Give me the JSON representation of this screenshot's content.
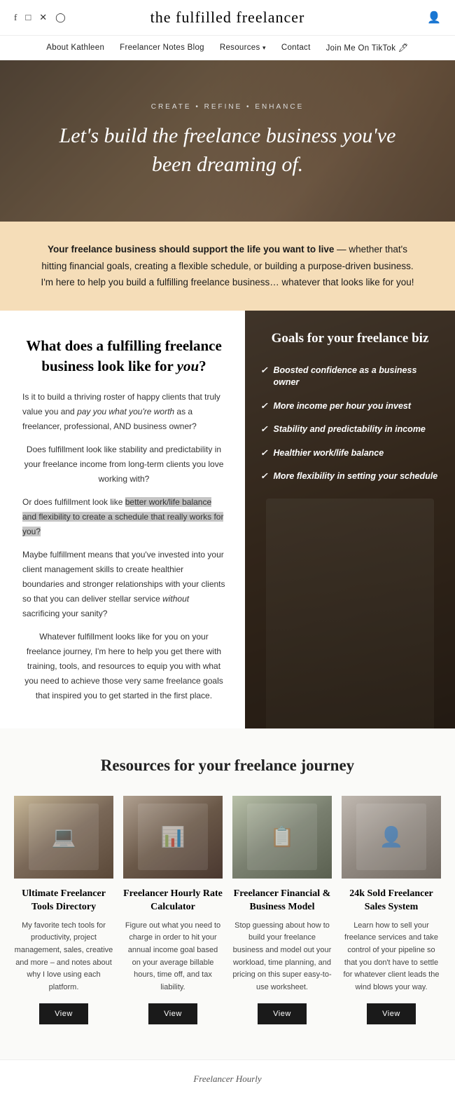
{
  "site": {
    "title": "the fulfilled freelancer",
    "tagline": "CREATE • REFINE • ENHANCE",
    "hero_headline": "Let's build the freelance business you've been dreaming of."
  },
  "social": {
    "icons": [
      "f",
      "i",
      "t",
      "p"
    ]
  },
  "nav": {
    "items": [
      {
        "label": "About Kathleen",
        "has_dropdown": false
      },
      {
        "label": "Freelancer Notes Blog",
        "has_dropdown": false
      },
      {
        "label": "Resources",
        "has_dropdown": true
      },
      {
        "label": "Contact",
        "has_dropdown": false
      },
      {
        "label": "Join Me On TikTok 🖊",
        "has_dropdown": false
      }
    ]
  },
  "intro": {
    "text_bold": "Your freelance business should support the life you want to live",
    "text_rest": " — whether that's hitting financial goals, creating a flexible schedule, or building a purpose-driven business. I'm here to help you build a fulfilling freelance business… whatever that looks like for you!"
  },
  "left_section": {
    "heading": "What does a fulfilling freelance business look like for ",
    "heading_italic": "you",
    "heading_end": "?",
    "paragraphs": [
      "Is it to build a thriving roster of happy clients that truly value you and pay you what you're worth as a freelancer, professional, AND business owner?",
      "Does fulfillment look like stability and predictability in your freelance income from long-term clients you love working with?",
      "Or does fulfillment look like better work/life balance and flexibility to create a schedule that really works for you?",
      "Maybe fulfillment means that you've invested into your client management skills to create healthier boundaries and stronger relationships with your clients so that you can deliver stellar service without sacrificing your sanity?",
      "Whatever fulfillment looks like for you on your freelance journey, I'm here to help you get there with training, tools, and resources to equip you with what you need to achieve those very same freelance goals that inspired you to get started in the first place."
    ],
    "highlighted_phrase": "look like better work/life balance and flexibility to create a schedule that really works for you?"
  },
  "goals": {
    "title": "Goals for your freelance biz",
    "items": [
      "Boosted confidence as a business owner",
      "More income per hour you invest",
      "Stability and predictability in income",
      "Healthier work/life balance",
      "More flexibility in setting your schedule"
    ]
  },
  "resources": {
    "section_title": "Resources for your freelance journey",
    "cards": [
      {
        "title": "Ultimate Freelancer Tools Directory",
        "desc": "My favorite tech tools for productivity, project management, sales, creative and more – and notes about why I love using each platform.",
        "btn_label": "View"
      },
      {
        "title": "Freelancer Hourly Rate Calculator",
        "desc": "Figure out what you need to charge in order to hit your annual income goal based on your average billable hours, time off, and tax liability.",
        "btn_label": "View"
      },
      {
        "title": "Freelancer Financial & Business Model",
        "desc": "Stop guessing about how to build your freelance business and model out your workload, time planning, and pricing on this super easy-to-use worksheet.",
        "btn_label": "View"
      },
      {
        "title": "24k Sold Freelancer Sales System",
        "desc": "Learn how to sell your freelance services and take control of your pipeline so that you don't have to settle for whatever client leads the wind blows your way.",
        "btn_label": "View"
      }
    ]
  },
  "footer": {
    "brand": "Freelancer Hourly"
  }
}
